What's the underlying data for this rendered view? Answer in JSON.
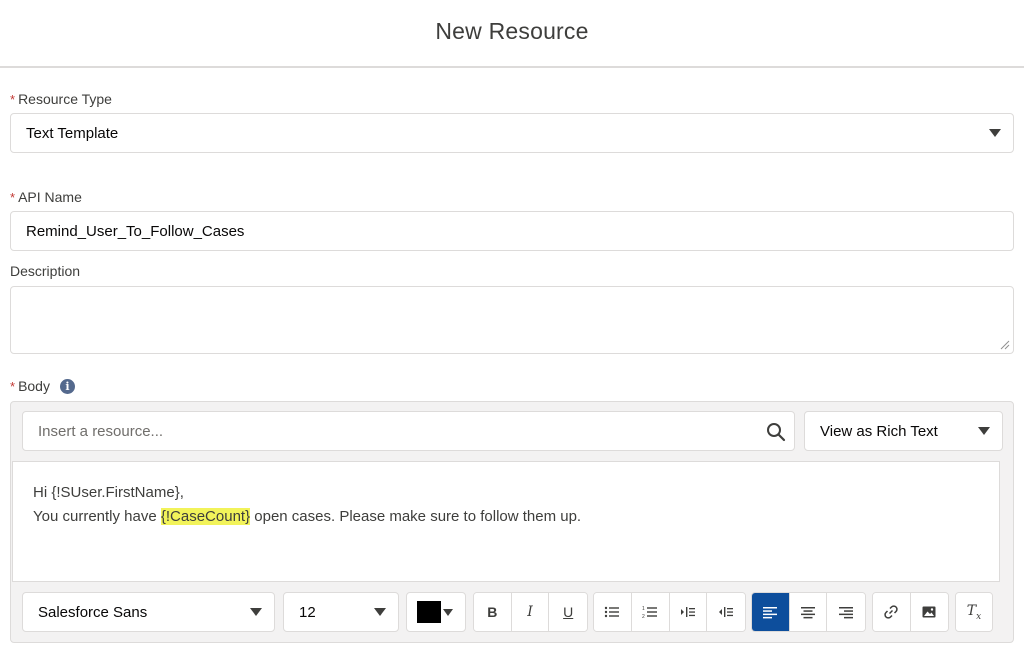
{
  "header": {
    "title": "New Resource"
  },
  "resource_type": {
    "label": "Resource Type",
    "required_mark": "*",
    "value": "Text Template"
  },
  "api_name": {
    "label": "API Name",
    "required_mark": "*",
    "value": "Remind_User_To_Follow_Cases"
  },
  "description": {
    "label": "Description",
    "value": ""
  },
  "body": {
    "label": "Body",
    "required_mark": "*",
    "info_icon": "info-icon",
    "search": {
      "placeholder": "Insert a resource..."
    },
    "view_mode": "View as Rich Text",
    "content": {
      "line1": "Hi {!SUser.FirstName},",
      "line2_before": "You currently have ",
      "line2_highlight": "{!CaseCount}",
      "line2_after": " open cases. Please make sure to follow them up."
    },
    "toolbar": {
      "font_family": "Salesforce Sans",
      "font_size": "12",
      "text_color": "#000000",
      "bold": "B",
      "italic": "I",
      "underline": "U",
      "clear_format": "Tx",
      "active_align": "left"
    }
  },
  "colors": {
    "required": "#c23934",
    "active_button": "#0d4e9c",
    "highlight": "#f2f35a",
    "border": "#dddbda"
  }
}
